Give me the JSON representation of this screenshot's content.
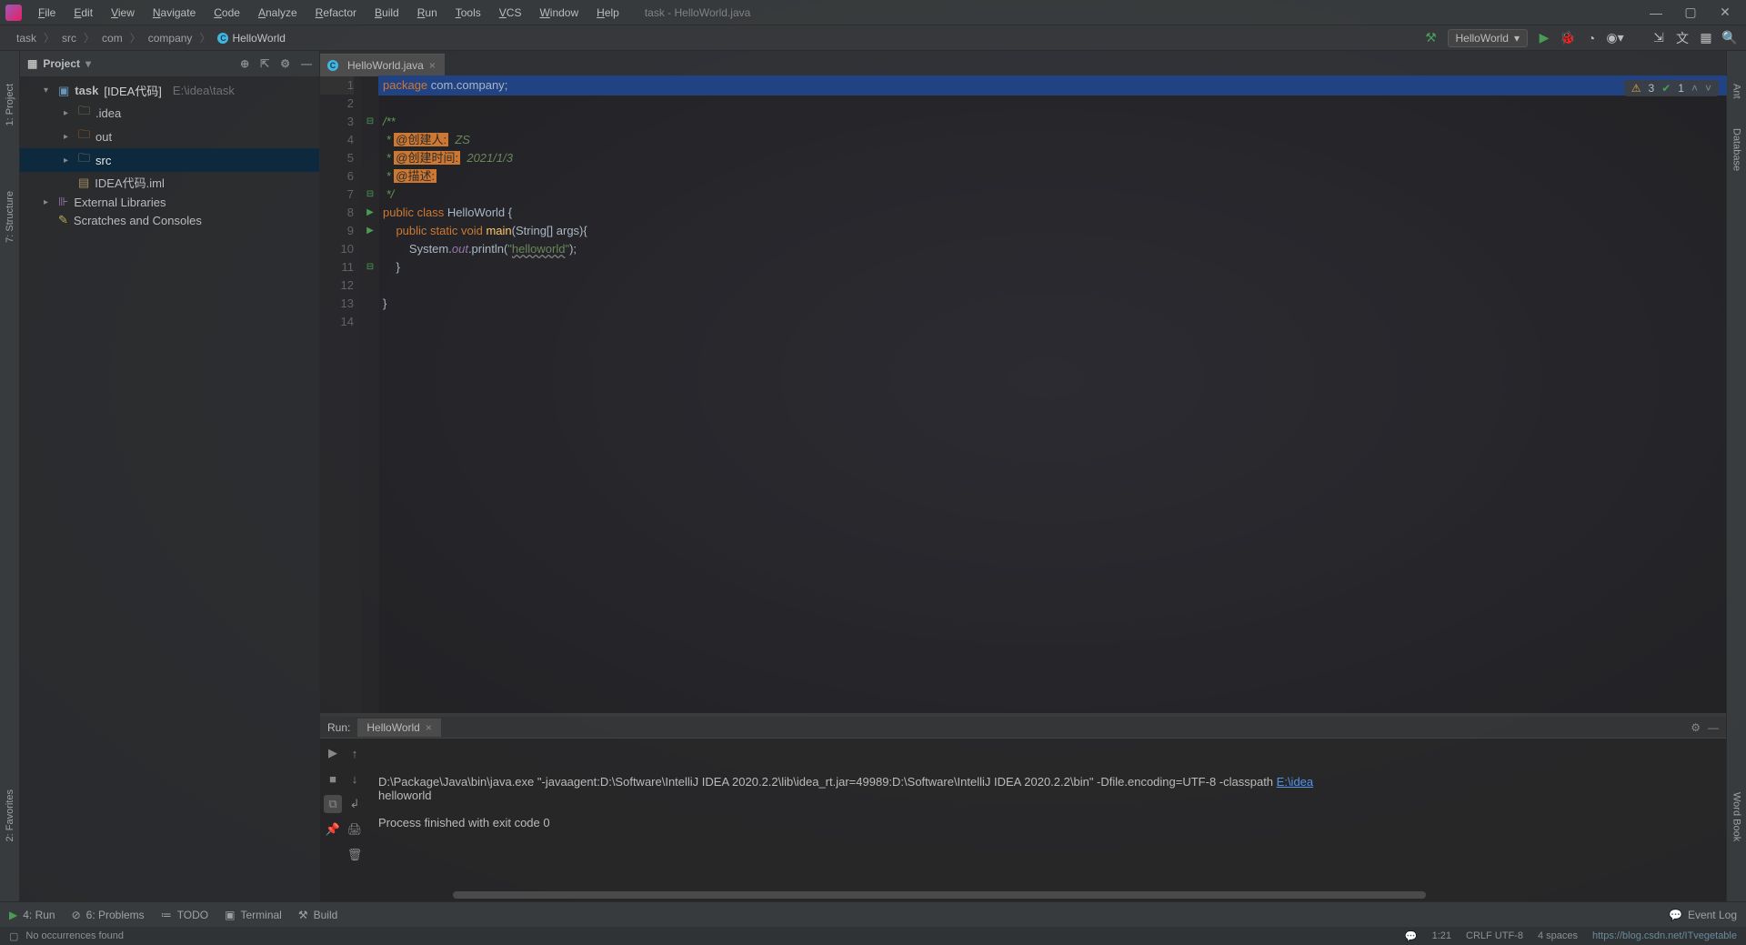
{
  "window_title": "task - HelloWorld.java",
  "menu": [
    "File",
    "Edit",
    "View",
    "Navigate",
    "Code",
    "Analyze",
    "Refactor",
    "Build",
    "Run",
    "Tools",
    "VCS",
    "Window",
    "Help"
  ],
  "breadcrumb": [
    "task",
    "src",
    "com",
    "company",
    "HelloWorld"
  ],
  "run_config_selected": "HelloWorld",
  "project": {
    "title": "Project",
    "root": {
      "name": "task",
      "tag": "[IDEA代码]",
      "path_hint": "E:\\idea\\task"
    },
    "children": [
      {
        "name": ".idea",
        "type": "folder"
      },
      {
        "name": "out",
        "type": "folder-orange"
      },
      {
        "name": "src",
        "type": "folder",
        "selected": true
      },
      {
        "name": "IDEA代码.iml",
        "type": "file"
      }
    ],
    "external": "External Libraries",
    "scratches": "Scratches and Consoles"
  },
  "tabs": [
    {
      "name": "HelloWorld.java"
    }
  ],
  "inspection": {
    "warnings": "3",
    "ok": "1"
  },
  "code_lines": [
    {
      "n": 1,
      "tokens": [
        [
          "kw",
          "package "
        ],
        [
          "pkg",
          "com.company"
        ],
        [
          "punc",
          ";"
        ]
      ],
      "current": true
    },
    {
      "n": 2,
      "tokens": []
    },
    {
      "n": 3,
      "ig": "⊟",
      "tokens": [
        [
          "cdoc",
          "/**"
        ]
      ]
    },
    {
      "n": 4,
      "tokens": [
        [
          "cdoc",
          " * "
        ],
        [
          "cdoc-tag",
          "@创建人:"
        ],
        [
          "cdoc-val",
          "  ZS"
        ]
      ]
    },
    {
      "n": 5,
      "tokens": [
        [
          "cdoc",
          " * "
        ],
        [
          "cdoc-tag",
          "@创建时间:"
        ],
        [
          "cdoc-val",
          "  2021/1/3"
        ]
      ]
    },
    {
      "n": 6,
      "tokens": [
        [
          "cdoc",
          " * "
        ],
        [
          "cdoc-tag",
          "@描述:"
        ]
      ]
    },
    {
      "n": 7,
      "ig": "⊟",
      "tokens": [
        [
          "cdoc",
          " */"
        ]
      ]
    },
    {
      "n": 8,
      "ig": "▶",
      "tokens": [
        [
          "kw",
          "public class "
        ],
        [
          "cls",
          "HelloWorld "
        ],
        [
          "punc",
          "{"
        ]
      ]
    },
    {
      "n": 9,
      "ig": "▶",
      "tokens": [
        [
          "punc",
          "    "
        ],
        [
          "kw",
          "public static void "
        ],
        [
          "mth",
          "main"
        ],
        [
          "punc",
          "(String[] args){"
        ]
      ]
    },
    {
      "n": 10,
      "tokens": [
        [
          "punc",
          "        System."
        ],
        [
          "field",
          "out"
        ],
        [
          "punc",
          ".println("
        ],
        [
          "str",
          "\""
        ],
        [
          "str u",
          "helloworld"
        ],
        [
          "str",
          "\""
        ],
        [
          "punc",
          ");"
        ]
      ]
    },
    {
      "n": 11,
      "ig": "⊟",
      "tokens": [
        [
          "punc",
          "    }"
        ]
      ]
    },
    {
      "n": 12,
      "tokens": []
    },
    {
      "n": 13,
      "tokens": [
        [
          "punc",
          "}"
        ]
      ]
    },
    {
      "n": 14,
      "tokens": []
    }
  ],
  "run": {
    "label": "Run:",
    "tab": "HelloWorld",
    "lines": [
      "D:\\Package\\Java\\bin\\java.exe \"-javaagent:D:\\Software\\IntelliJ IDEA 2020.2.2\\lib\\idea_rt.jar=49989:D:\\Software\\IntelliJ IDEA 2020.2.2\\bin\" -Dfile.encoding=UTF-8 -classpath E:\\idea",
      "helloworld",
      "",
      "Process finished with exit code 0"
    ]
  },
  "bottom": {
    "run": "4: Run",
    "problems": "6: Problems",
    "todo": "TODO",
    "terminal": "Terminal",
    "build": "Build",
    "eventlog": "Event Log"
  },
  "left_tabs": {
    "project": "1: Project",
    "structure": "7: Structure",
    "favorites": "2: Favorites"
  },
  "right_tabs": {
    "ant": "Ant",
    "database": "Database",
    "wordbook": "Word Book"
  },
  "status": {
    "msg": "No occurrences found",
    "pos": "1:21",
    "encoding": "CRLF  UTF-8",
    "spaces": "4 spaces",
    "branch": "https://blog.csdn.net/ITvegetable"
  }
}
